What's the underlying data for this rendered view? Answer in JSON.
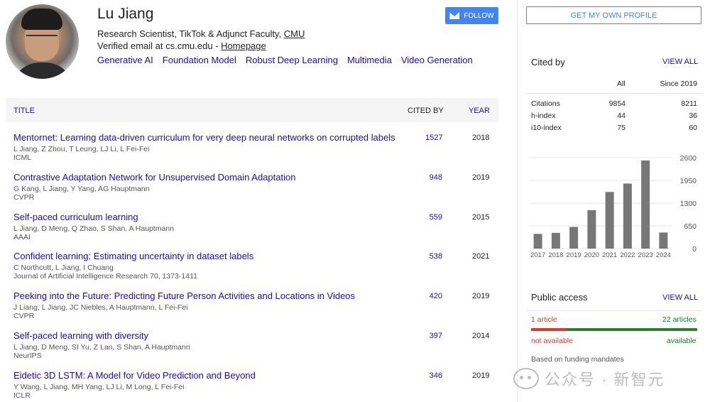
{
  "profile": {
    "name": "Lu Jiang",
    "affiliation_prefix": "Research Scientist, TikTok & Adjunct Faculty, ",
    "affiliation_link": "CMU",
    "email_prefix": "Verified email at cs.cmu.edu - ",
    "homepage": "Homepage",
    "interests": [
      "Generative AI",
      "Foundation Model",
      "Robust Deep Learning",
      "Multimedia",
      "Video Generation"
    ],
    "follow_label": "FOLLOW"
  },
  "table": {
    "col_title": "TITLE",
    "col_cited": "CITED BY",
    "col_year": "YEAR",
    "rows": [
      {
        "title": "Mentornet: Learning data-driven curriculum for very deep neural networks on corrupted labels",
        "authors": "L Jiang, Z Zhou, T Leung, LJ Li, L Fei-Fei",
        "venue": "ICML",
        "cited": "1527",
        "year": "2018"
      },
      {
        "title": "Contrastive Adaptation Network for Unsupervised Domain Adaptation",
        "authors": "G Kang, L Jiang, Y Yang, AG Hauptmann",
        "venue": "CVPR",
        "cited": "948",
        "year": "2019"
      },
      {
        "title": "Self-paced curriculum learning",
        "authors": "L Jiang, D Meng, Q Zhao, S Shan, A Hauptmann",
        "venue": "AAAI",
        "cited": "559",
        "year": "2015"
      },
      {
        "title": "Confident learning: Estimating uncertainty in dataset labels",
        "authors": "C Northcutt, L Jiang, I Chuang",
        "venue": "Journal of Artificial Intelligence Research 70, 1373-1411",
        "cited": "538",
        "year": "2021"
      },
      {
        "title": "Peeking into the Future: Predicting Future Person Activities and Locations in Videos",
        "authors": "J Liang, L Jiang, JC Niebles, A Hauptmann, L Fei-Fei",
        "venue": "CVPR",
        "cited": "420",
        "year": "2019"
      },
      {
        "title": "Self-paced learning with diversity",
        "authors": "L Jiang, D Meng, SI Yu, Z Lan, S Shan, A Hauptmann",
        "venue": "NeurIPS",
        "cited": "397",
        "year": "2014"
      },
      {
        "title": "Eidetic 3D LSTM: A Model for Video Prediction and Beyond",
        "authors": "Y Wang, L Jiang, MH Yang, LJ Li, M Long, L Fei-Fei",
        "venue": "ICLR",
        "cited": "346",
        "year": "2019"
      }
    ]
  },
  "sidebar": {
    "get_profile": "GET MY OWN PROFILE",
    "cited_by": "Cited by",
    "view_all": "VIEW ALL",
    "col_all": "All",
    "col_since": "Since 2019",
    "stats": [
      {
        "label": "Citations",
        "all": "9854",
        "since": "8211"
      },
      {
        "label": "h-index",
        "all": "44",
        "since": "36"
      },
      {
        "label": "i10-index",
        "all": "75",
        "since": "60"
      }
    ],
    "public_access": "Public access",
    "pa_view_all": "VIEW ALL",
    "pa_not_available_count": "1 article",
    "pa_available_count": "22 articles",
    "pa_not_available": "not available",
    "pa_available": "available",
    "pa_available_fraction": 0.957,
    "funding": "Based on funding mandates",
    "watermark": "公众号 · 新智元"
  },
  "chart_data": {
    "type": "bar",
    "categories": [
      "2017",
      "2018",
      "2019",
      "2020",
      "2021",
      "2022",
      "2023",
      "2024"
    ],
    "values": [
      420,
      450,
      620,
      1100,
      1620,
      1860,
      2520,
      460
    ],
    "yticks": [
      "2600",
      "1950",
      "1300",
      "650",
      "0"
    ],
    "ylim": [
      0,
      2600
    ],
    "bar_color": "#777777",
    "grid": true
  },
  "colors": {
    "link": "#1a0dab",
    "accent": "#4285f4",
    "red": "#d23f31",
    "green": "#0f7c3a"
  }
}
